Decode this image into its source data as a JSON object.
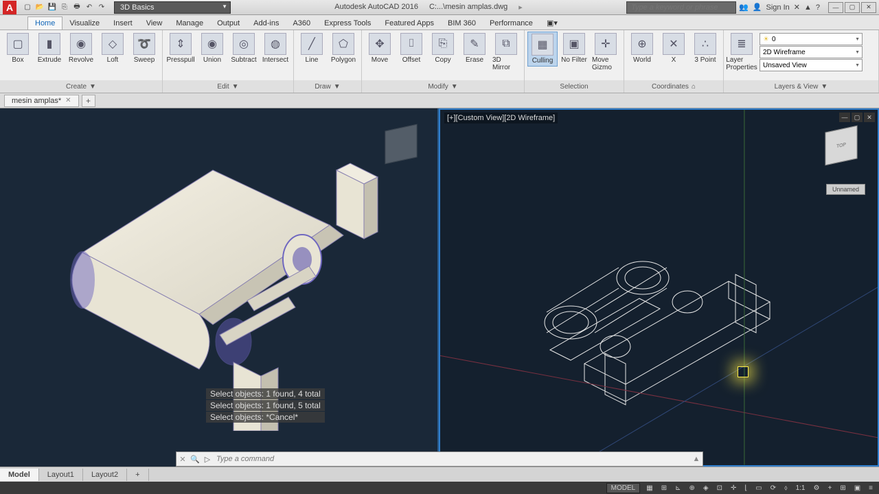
{
  "app": {
    "title": "Autodesk AutoCAD 2016",
    "file": "C:...\\mesin amplas.dwg",
    "workspace": "3D Basics",
    "search_placeholder": "Type a keyword or phrase",
    "sign_in": "Sign In"
  },
  "tabs": [
    "Home",
    "Visualize",
    "Insert",
    "View",
    "Manage",
    "Output",
    "Add-ins",
    "A360",
    "Express Tools",
    "Featured Apps",
    "BIM 360",
    "Performance"
  ],
  "active_tab": "Home",
  "ribbon": {
    "create": {
      "title": "Create",
      "items": [
        "Box",
        "Extrude",
        "Revolve",
        "Loft",
        "Sweep"
      ]
    },
    "edit": {
      "title": "Edit",
      "items": [
        "Presspull",
        "Union",
        "Subtract",
        "Intersect"
      ]
    },
    "draw": {
      "title": "Draw",
      "items": [
        "Line",
        "Polygon"
      ]
    },
    "modify": {
      "title": "Modify",
      "items": [
        "Move",
        "Offset",
        "Copy",
        "Erase",
        "3D Mirror"
      ]
    },
    "selection": {
      "title": "Selection",
      "items": [
        "Culling",
        "No Filter",
        "Move Gizmo"
      ]
    },
    "coordinates": {
      "title": "Coordinates",
      "items": [
        "World",
        "X",
        "3 Point"
      ]
    },
    "layers": {
      "title": "Layers & View",
      "layer_props": "Layer Properties",
      "style": "2D Wireframe",
      "view": "Unsaved View",
      "layer_current": "0"
    }
  },
  "file_tab": "mesin amplas*",
  "viewport_right_label": "[+][Custom View][2D Wireframe]",
  "viewcube_btn": "Unnamed",
  "cmd_history": [
    "Select objects: 1 found, 4 total",
    "Select objects: 1 found, 5 total",
    "Select objects: *Cancel*"
  ],
  "cmd_placeholder": "Type a command",
  "layout_tabs": [
    "Model",
    "Layout1",
    "Layout2"
  ],
  "status": {
    "model": "MODEL",
    "scale": "1:1"
  }
}
